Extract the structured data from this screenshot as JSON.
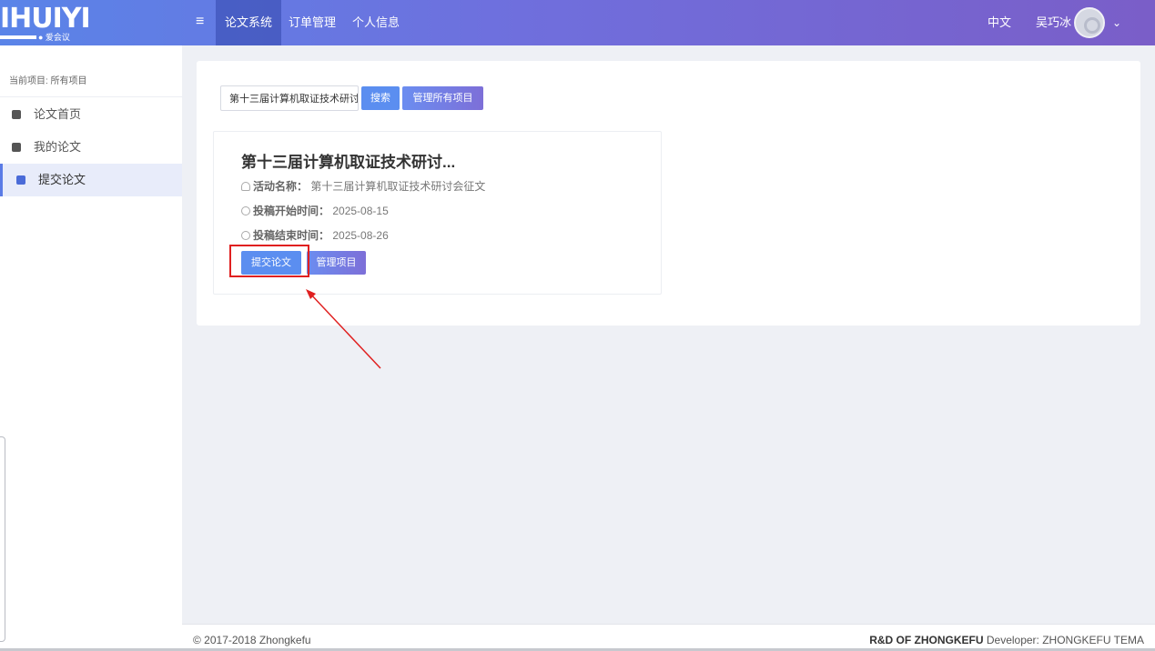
{
  "header": {
    "logo_text": "IHUIYI",
    "logo_sub": "● 爱会议",
    "menu_icon": "≡",
    "nav": [
      {
        "label": "论文系统",
        "active": true
      },
      {
        "label": "订单管理",
        "active": false
      },
      {
        "label": "个人信息",
        "active": false
      }
    ],
    "language": "中文",
    "user_name": "吴巧冰",
    "caret": "⌄"
  },
  "sidebar": {
    "breadcrumb": "当前项目: 所有项目",
    "items": [
      {
        "label": "论文首页",
        "active": false
      },
      {
        "label": "我的论文",
        "active": false
      },
      {
        "label": "提交论文",
        "active": true
      }
    ]
  },
  "search": {
    "value": "第十三届计算机取证技术研讨会征文",
    "search_button": "搜索",
    "manage_all_button": "管理所有项目"
  },
  "card": {
    "title": "第十三届计算机取证技术研讨...",
    "activity_label": "活动名称：",
    "activity_value": "第十三届计算机取证技术研讨会征文",
    "start_label": "投稿开始时间：",
    "start_value": "2025-08-15",
    "end_label": "投稿结束时间：",
    "end_value": "2025-08-26",
    "submit_button": "提交论文",
    "manage_button": "管理项目"
  },
  "footer": {
    "copyright": "© 2017-2018 Zhongkefu",
    "rd_bold": "R&D OF ZHONGKEFU",
    "developer": " Developer: ZHONGKEFU TEMA"
  },
  "colors": {
    "header_gradient_start": "#5a84e8",
    "header_gradient_end": "#7a5ec8",
    "accent_blue": "#5b8ef0",
    "highlight_red": "#e02020"
  }
}
